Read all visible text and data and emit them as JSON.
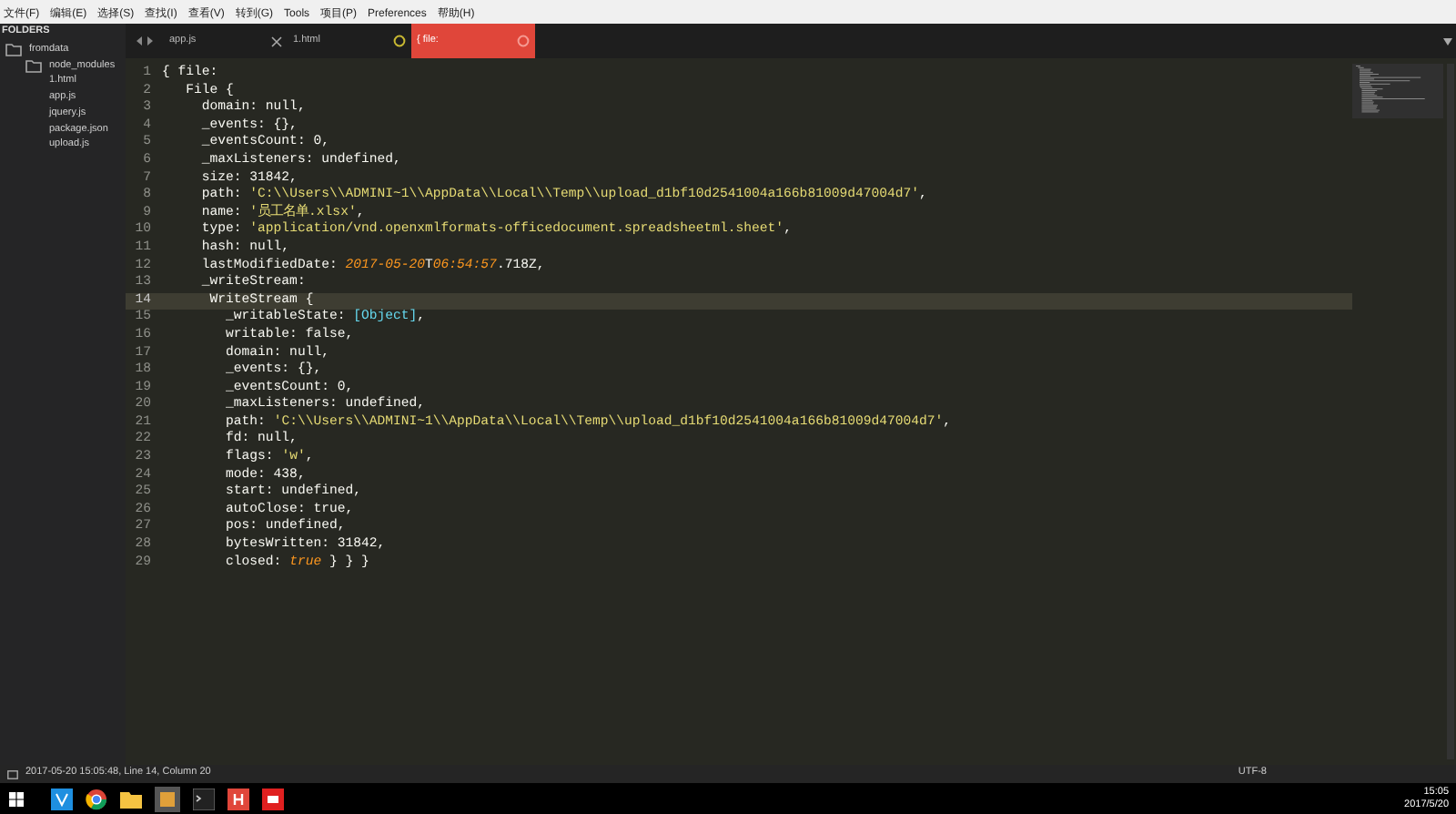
{
  "menu": [
    "文件(F)",
    "编辑(E)",
    "选择(S)",
    "查找(I)",
    "查看(V)",
    "转到(G)",
    "Tools",
    "项目(P)",
    "Preferences",
    "帮助(H)"
  ],
  "sidebar": {
    "title": "FOLDERS",
    "tree": [
      {
        "label": "fromdata",
        "kind": "folder",
        "children": [
          {
            "label": "node_modules",
            "kind": "folder"
          },
          {
            "label": "1.html",
            "kind": "file"
          },
          {
            "label": "app.js",
            "kind": "file"
          },
          {
            "label": "jquery.js",
            "kind": "file"
          },
          {
            "label": "package.json",
            "kind": "file"
          },
          {
            "label": "upload.js",
            "kind": "file"
          }
        ]
      }
    ]
  },
  "tabs": [
    {
      "label": "app.js",
      "selected": false,
      "dirty": false
    },
    {
      "label": "1.html",
      "selected": false,
      "dirty": true
    },
    {
      "label": "{ file:",
      "selected": true,
      "dirty": true
    }
  ],
  "editor": {
    "lines": [
      {
        "n": "1",
        "current": false,
        "parts": [
          {
            "t": "{ file:",
            "kind": "plain"
          }
        ]
      },
      {
        "n": "2",
        "current": false,
        "parts": [
          {
            "t": "   File {",
            "kind": "plain"
          }
        ]
      },
      {
        "n": "3",
        "current": false,
        "parts": [
          {
            "t": "     domain: null,",
            "kind": "plain"
          }
        ]
      },
      {
        "n": "4",
        "current": false,
        "parts": [
          {
            "t": "     _events: {},",
            "kind": "plain"
          }
        ]
      },
      {
        "n": "5",
        "current": false,
        "parts": [
          {
            "t": "     _eventsCount: 0,",
            "kind": "plain"
          }
        ]
      },
      {
        "n": "6",
        "current": false,
        "parts": [
          {
            "t": "     _maxListeners: undefined,",
            "kind": "plain"
          }
        ]
      },
      {
        "n": "7",
        "current": false,
        "parts": [
          {
            "t": "     size: 31842,",
            "kind": "plain"
          }
        ]
      },
      {
        "n": "8",
        "current": false,
        "parts": [
          {
            "t": "     path: ",
            "kind": "plain"
          },
          {
            "t": "'C:\\\\Users\\\\ADMINI~1\\\\AppData\\\\Local\\\\Temp\\\\upload_d1bf10d2541004a166b81009d47004d7'",
            "kind": "string"
          },
          {
            "t": ",",
            "kind": "plain"
          }
        ]
      },
      {
        "n": "9",
        "current": false,
        "parts": [
          {
            "t": "     name: ",
            "kind": "plain"
          },
          {
            "t": "'员工名单.xlsx'",
            "kind": "string"
          },
          {
            "t": ",",
            "kind": "plain"
          }
        ]
      },
      {
        "n": "10",
        "current": false,
        "parts": [
          {
            "t": "     type: ",
            "kind": "plain"
          },
          {
            "t": "'application/vnd.openxmlformats-officedocument.spreadsheetml.sheet'",
            "kind": "string"
          },
          {
            "t": ",",
            "kind": "plain"
          }
        ]
      },
      {
        "n": "11",
        "current": false,
        "parts": [
          {
            "t": "     hash: null,",
            "kind": "plain"
          }
        ]
      },
      {
        "n": "12",
        "current": false,
        "parts": [
          {
            "t": "     lastModifiedDate: ",
            "kind": "plain"
          },
          {
            "t": "2017-05-20",
            "kind": "literal"
          },
          {
            "t": "T",
            "kind": "plain"
          },
          {
            "t": "06:54:57",
            "kind": "literal"
          },
          {
            "t": ".718Z,",
            "kind": "plain"
          }
        ]
      },
      {
        "n": "13",
        "current": false,
        "parts": [
          {
            "t": "     _writeStream:",
            "kind": "plain"
          }
        ]
      },
      {
        "n": "14",
        "current": true,
        "parts": [
          {
            "t": "      WriteStream {",
            "kind": "plain"
          }
        ]
      },
      {
        "n": "15",
        "current": false,
        "parts": [
          {
            "t": "        _writableState: ",
            "kind": "plain"
          },
          {
            "t": "[Object]",
            "kind": "object"
          },
          {
            "t": ",",
            "kind": "plain"
          }
        ]
      },
      {
        "n": "16",
        "current": false,
        "parts": [
          {
            "t": "        writable: false,",
            "kind": "plain"
          }
        ]
      },
      {
        "n": "17",
        "current": false,
        "parts": [
          {
            "t": "        domain: null,",
            "kind": "plain"
          }
        ]
      },
      {
        "n": "18",
        "current": false,
        "parts": [
          {
            "t": "        _events: {},",
            "kind": "plain"
          }
        ]
      },
      {
        "n": "19",
        "current": false,
        "parts": [
          {
            "t": "        _eventsCount: 0,",
            "kind": "plain"
          }
        ]
      },
      {
        "n": "20",
        "current": false,
        "parts": [
          {
            "t": "        _maxListeners: undefined,",
            "kind": "plain"
          }
        ]
      },
      {
        "n": "21",
        "current": false,
        "parts": [
          {
            "t": "        path: ",
            "kind": "plain"
          },
          {
            "t": "'C:\\\\Users\\\\ADMINI~1\\\\AppData\\\\Local\\\\Temp\\\\upload_d1bf10d2541004a166b81009d47004d7'",
            "kind": "string"
          },
          {
            "t": ",",
            "kind": "plain"
          }
        ]
      },
      {
        "n": "22",
        "current": false,
        "parts": [
          {
            "t": "        fd: null,",
            "kind": "plain"
          }
        ]
      },
      {
        "n": "23",
        "current": false,
        "parts": [
          {
            "t": "        flags: ",
            "kind": "plain"
          },
          {
            "t": "'w'",
            "kind": "string"
          },
          {
            "t": ",",
            "kind": "plain"
          }
        ]
      },
      {
        "n": "24",
        "current": false,
        "parts": [
          {
            "t": "        mode: 438,",
            "kind": "plain"
          }
        ]
      },
      {
        "n": "25",
        "current": false,
        "parts": [
          {
            "t": "        start: undefined,",
            "kind": "plain"
          }
        ]
      },
      {
        "n": "26",
        "current": false,
        "parts": [
          {
            "t": "        autoClose: true,",
            "kind": "plain"
          }
        ]
      },
      {
        "n": "27",
        "current": false,
        "parts": [
          {
            "t": "        pos: undefined,",
            "kind": "plain"
          }
        ]
      },
      {
        "n": "28",
        "current": false,
        "parts": [
          {
            "t": "        bytesWritten: 31842,",
            "kind": "plain"
          }
        ]
      },
      {
        "n": "29",
        "current": false,
        "parts": [
          {
            "t": "        closed: ",
            "kind": "plain"
          },
          {
            "t": "true",
            "kind": "literal"
          },
          {
            "t": " } } }",
            "kind": "plain"
          }
        ]
      }
    ]
  },
  "status_bar": {
    "message": "2017-05-20 15:05:48, Line 14, Column 20",
    "encoding": "UTF-8"
  },
  "taskbar": {
    "time": "15:05",
    "date": "2017/5/20"
  }
}
